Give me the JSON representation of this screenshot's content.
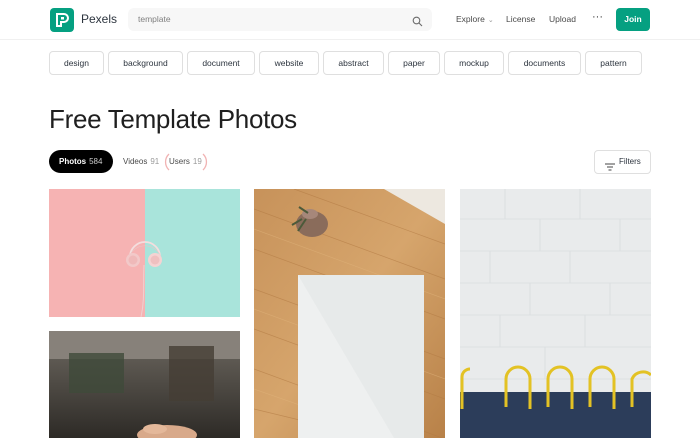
{
  "header": {
    "brand": "Pexels",
    "search_placeholder": "template",
    "nav": {
      "explore": "Explore",
      "license": "License",
      "upload": "Upload",
      "more": "···"
    },
    "join_label": "Join"
  },
  "tags": [
    "design",
    "background",
    "document",
    "website",
    "abstract",
    "paper",
    "mockup",
    "documents",
    "pattern"
  ],
  "page_title": "Free Template Photos",
  "tabs": {
    "photos": {
      "label": "Photos",
      "count": "584"
    },
    "videos": {
      "label": "Videos",
      "count": "91"
    },
    "users": {
      "label": "Users",
      "count": "19"
    }
  },
  "filters_label": "Filters",
  "colors": {
    "brand": "#05a081",
    "active_tab": "#000000"
  },
  "icons": {
    "search": "search-icon",
    "filters": "filters-icon",
    "logo": "pexels-logo-icon"
  }
}
